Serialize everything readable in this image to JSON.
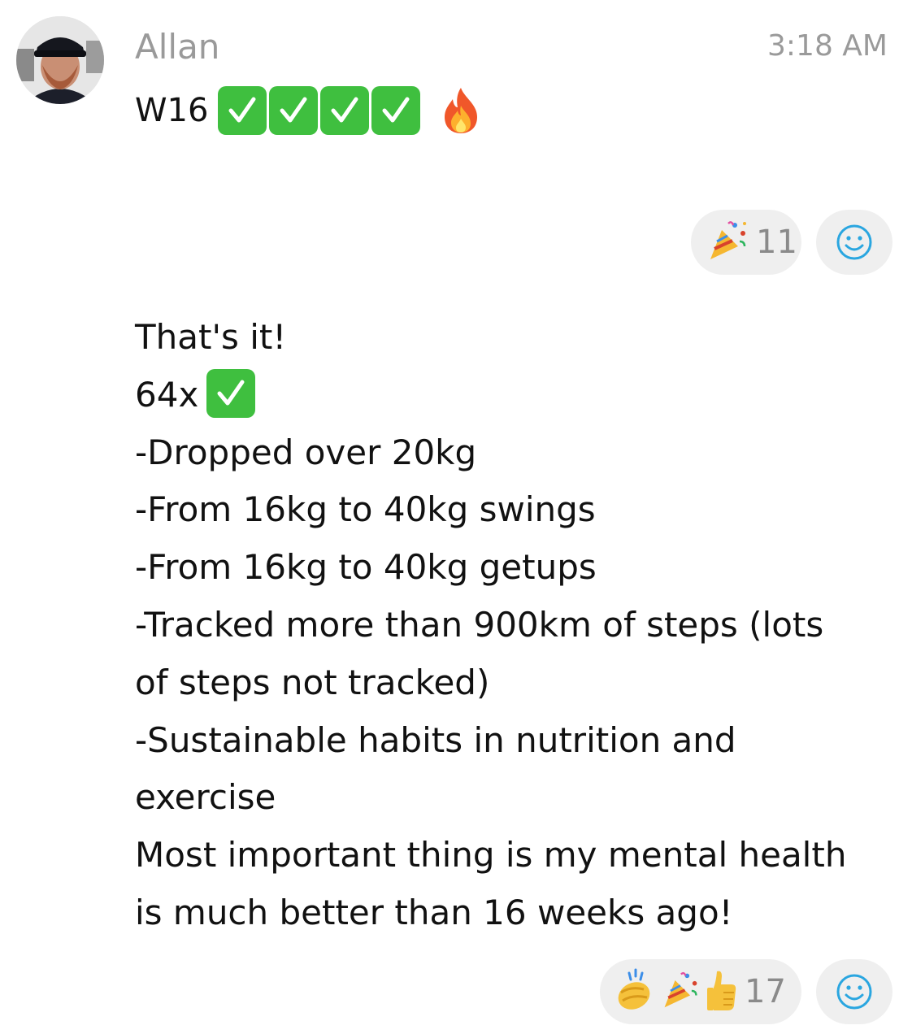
{
  "message": {
    "author": "Allan",
    "time": "3:18 AM",
    "header_text": "W16",
    "header_checks": 4,
    "reactions_top": {
      "emoji": [
        "party-popper"
      ],
      "count": "11"
    },
    "body": {
      "line1": "That's it!",
      "line2_prefix": "64x",
      "line3": "-Dropped over 20kg",
      "line4": "-From 16kg to 40kg swings",
      "line5": "-From 16kg to 40kg getups",
      "line6": "-Tracked more than 900km of steps (lots",
      "line7": "of steps not tracked)",
      "line8": "-Sustainable habits in nutrition and",
      "line9": "exercise",
      "line10": "Most important thing is my mental health",
      "line11": "is much better than 16 weeks ago!"
    },
    "reactions_bottom": {
      "emoji": [
        "clapping-hands",
        "party-popper",
        "thumbs-up"
      ],
      "count": "17"
    }
  },
  "colors": {
    "check_green": "#3fbf3f",
    "muted_text": "#9a9a9a",
    "pill_bg": "#efefef",
    "smiley_blue": "#2aa6e0"
  }
}
